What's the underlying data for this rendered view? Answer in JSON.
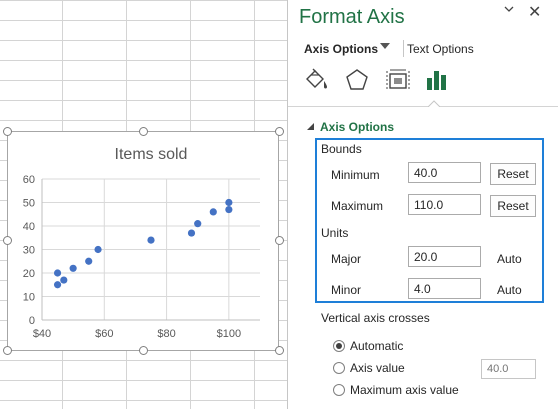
{
  "chart_data": {
    "type": "scatter",
    "title": "Items sold",
    "xlabel": "",
    "ylabel": "",
    "xlim": [
      40,
      110
    ],
    "ylim": [
      0,
      60
    ],
    "x_ticks": [
      40,
      60,
      80,
      100
    ],
    "x_tick_labels": [
      "$40",
      "$60",
      "$80",
      "$100"
    ],
    "y_ticks": [
      0,
      10,
      20,
      30,
      40,
      50,
      60
    ],
    "y_tick_labels": [
      "0",
      "10",
      "20",
      "30",
      "40",
      "50",
      "60"
    ],
    "grid": true,
    "marker_color": "#4472c4",
    "points": [
      {
        "x": 45,
        "y": 20
      },
      {
        "x": 45,
        "y": 15
      },
      {
        "x": 47,
        "y": 17
      },
      {
        "x": 50,
        "y": 22
      },
      {
        "x": 55,
        "y": 25
      },
      {
        "x": 58,
        "y": 30
      },
      {
        "x": 75,
        "y": 34
      },
      {
        "x": 88,
        "y": 37
      },
      {
        "x": 90,
        "y": 41
      },
      {
        "x": 95,
        "y": 46
      },
      {
        "x": 100,
        "y": 47
      },
      {
        "x": 100,
        "y": 50
      }
    ]
  },
  "pane": {
    "title": "Format Axis",
    "collapse_icon": "chevron-down-icon",
    "close_label": "✕",
    "tabs": {
      "axis_options": "Axis Options",
      "text_options": "Text Options"
    },
    "category_icons": [
      "fill-line-icon",
      "effects-pentagon-icon",
      "size-properties-icon",
      "axis-options-bar-chart-icon"
    ],
    "section_title": "Axis Options",
    "bounds": {
      "label": "Bounds",
      "minimum_label": "Minimum",
      "minimum_value": "40.0",
      "minimum_action": "Reset",
      "maximum_label": "Maximum",
      "maximum_value": "110.0",
      "maximum_action": "Reset"
    },
    "units": {
      "label": "Units",
      "major_label": "Major",
      "major_value": "20.0",
      "major_action": "Auto",
      "minor_label": "Minor",
      "minor_value": "4.0",
      "minor_action": "Auto"
    },
    "crosses": {
      "label": "Vertical axis crosses",
      "options": [
        {
          "label": "Automatic",
          "checked": true
        },
        {
          "label": "Axis value",
          "checked": false
        },
        {
          "label": "Maximum axis value",
          "checked": false
        }
      ],
      "axis_value_placeholder": "40.0"
    },
    "accent_color": "#217346",
    "highlight_color": "#1e7fd8"
  }
}
